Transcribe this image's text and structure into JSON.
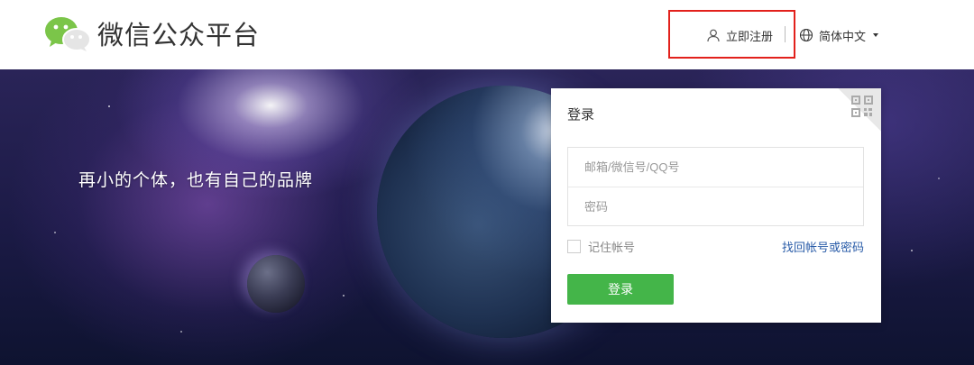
{
  "header": {
    "title": "微信公众平台",
    "register_label": "立即注册",
    "language_label": "简体中文",
    "logo_icon": "wechat-logo-icon",
    "register_icon": "user-icon",
    "language_icon": "globe-icon"
  },
  "banner": {
    "slogan": "再小的个体，也有自己的品牌"
  },
  "login": {
    "title": "登录",
    "account_placeholder": "邮箱/微信号/QQ号",
    "password_placeholder": "密码",
    "remember_label": "记住帐号",
    "forgot_label": "找回帐号或密码",
    "submit_label": "登录",
    "qr_icon": "qr-code-icon"
  },
  "colors": {
    "brand_green": "#44b549",
    "highlight_red": "#e2211c",
    "link_blue": "#2a5ca8"
  }
}
